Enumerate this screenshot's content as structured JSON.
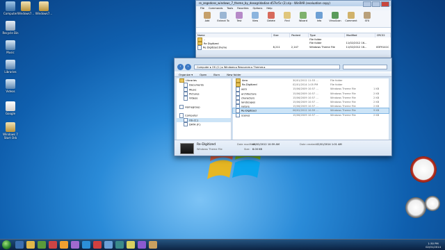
{
  "desktop": {
    "icons": [
      {
        "label": "Computer"
      },
      {
        "label": "Windows7..."
      },
      {
        "label": "Windows7..."
      },
      {
        "label": "Recycle Bin"
      },
      {
        "label": "Music"
      },
      {
        "label": "Libraries"
      },
      {
        "label": "Videos"
      },
      {
        "label": "Google"
      },
      {
        "label": "Windows 7 Start Orb"
      }
    ]
  },
  "winrar": {
    "title": "re_zegedons_windows_7_theme_by_dosogridadian-d57kr5c (2).zip - WinRAR (evaluation copy)",
    "menu": [
      "File",
      "Commands",
      "Tools",
      "Favorites",
      "Options",
      "Help"
    ],
    "tools": [
      "Add",
      "Extract To",
      "Test",
      "View",
      "Delete",
      "Find",
      "Wizard",
      "Info",
      "VirusScan",
      "Comment",
      "SFX"
    ],
    "columns": [
      "Name",
      "Size",
      "Packed",
      "Type",
      "Modified",
      "CRC32"
    ],
    "rows": [
      {
        "name": "..",
        "size": "",
        "packed": "",
        "type": "File folder",
        "modified": "",
        "crc": ""
      },
      {
        "name": "Re Digitized",
        "size": "",
        "packed": "",
        "type": "File folder",
        "modified": "11/02/2012 16...",
        "crc": ""
      },
      {
        "name": "Re Digitized.theme",
        "size": "8,211",
        "packed": "2,147",
        "type": "Windows Theme File",
        "modified": "11/02/2012 16...",
        "crc": "83F9141C"
      }
    ]
  },
  "explorer": {
    "address": "Computer  ▸  OS (C:)  ▸  Windows  ▸  Resources  ▸  Themes  ▸",
    "search_placeholder": "Search Themes",
    "commands": [
      "Organize ▾",
      "Open",
      "Burn",
      "New folder"
    ],
    "nav": [
      "Libraries",
      "Documents",
      "Music",
      "Pictures",
      "Videos",
      "",
      "Homegroup",
      "",
      "Computer",
      "OS (C:)",
      "DATA (F:)"
    ],
    "files": [
      {
        "name": "Aero",
        "date": "30/01/2012 11:53 ...",
        "type": "File folder",
        "size": ""
      },
      {
        "name": "Re-Digitized",
        "date": "02/01/2014 1:05 PM",
        "type": "File folder",
        "size": ""
      },
      {
        "name": "aero",
        "date": "15/06/2009 10:57 ...",
        "type": "Windows Theme File",
        "size": "1 KB"
      },
      {
        "name": "architecture",
        "date": "15/06/2009 10:57 ...",
        "type": "Windows Theme File",
        "size": "2 KB"
      },
      {
        "name": "characters",
        "date": "15/06/2009 10:57 ...",
        "type": "Windows Theme File",
        "size": "2 KB"
      },
      {
        "name": "landscapes",
        "date": "15/06/2009 10:57 ...",
        "type": "Windows Theme File",
        "size": "2 KB"
      },
      {
        "name": "nature",
        "date": "15/06/2009 10:57 ...",
        "type": "Windows Theme File",
        "size": "2 KB"
      },
      {
        "name": "Re-Digitized",
        "date": "06/02/2012 10:59 ...",
        "type": "Windows Theme File",
        "size": "9 KB"
      },
      {
        "name": "scenes",
        "date": "15/06/2009 10:57 ...",
        "type": "Windows Theme File",
        "size": "2 KB"
      }
    ],
    "details": {
      "name": "Re-Digitized",
      "kind": "Windows Theme File",
      "modified_label": "Date modified:",
      "modified": "06/02/2012 10:59 AM",
      "size_label": "Size:",
      "size": "8.00 KB",
      "created_label": "Date created:",
      "created": "02/01/2014 1:01 AM"
    }
  },
  "taskbar": {
    "time": "1:30 PM",
    "date": "02/01/2014"
  }
}
